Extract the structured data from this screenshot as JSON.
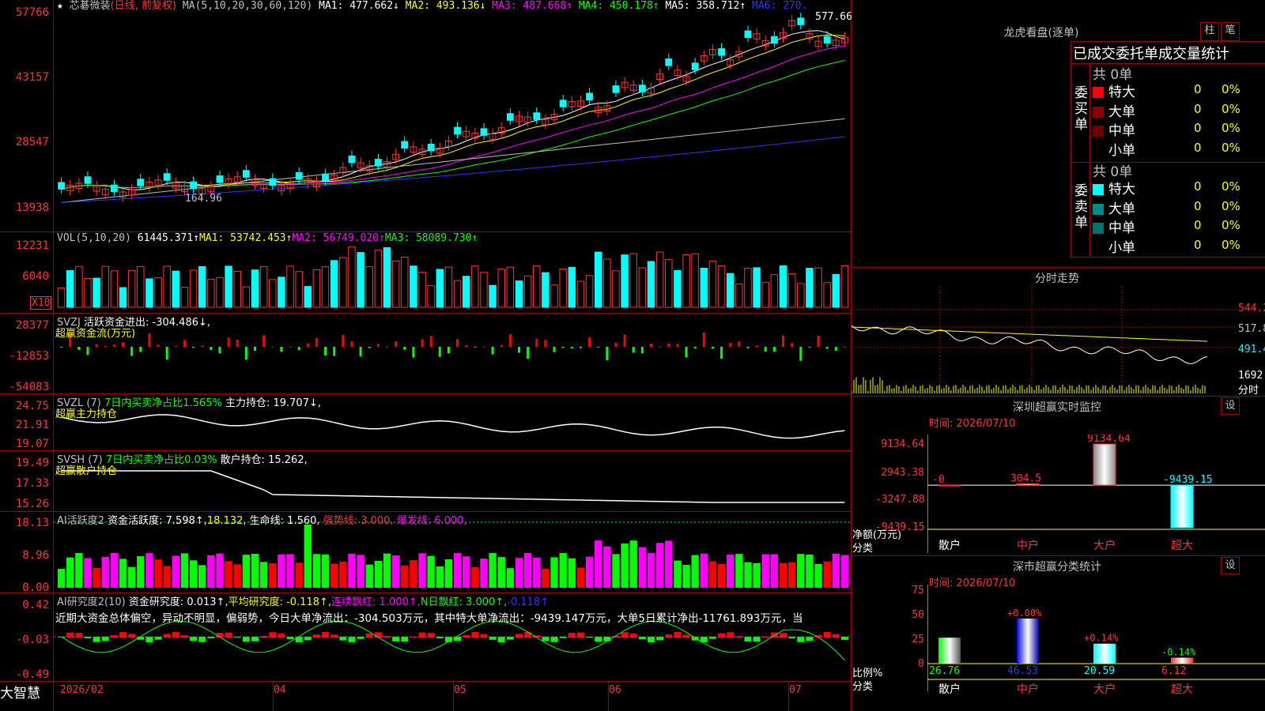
{
  "header": {
    "star": "★",
    "stock_name": "芯碁微装",
    "period": "(日线, 前复权)",
    "ma_label": "MA(5,10,20,30,60,120)",
    "ma1": "MA1: 477.662↓",
    "ma2": "MA2: 493.136↓",
    "ma3": "MA3: 487.668↑",
    "ma4": "MA4: 450.178↑",
    "ma5": "MA5: 358.712↑",
    "ma6": "MA6: 270."
  },
  "price_axis": [
    "57766",
    "43157",
    "28547",
    "13938"
  ],
  "price_annotations": {
    "high": "577.66",
    "low": "164.96"
  },
  "vol": {
    "label": "VOL(5,10,20)",
    "value": "61445.371↑",
    "ma1": "MA1: 53742.453↑",
    "ma2": "MA2: 56749.020↑",
    "ma3": "MA3: 58089.730↑",
    "axis": [
      "12231",
      "6040"
    ],
    "unit": "X10"
  },
  "svzj": {
    "label": "SVZJ",
    "line1": "活跃资金进出: -304.486↓,",
    "line2": "超赢资金流(万元)",
    "axis": [
      "28377",
      "-12853",
      "-54083"
    ]
  },
  "svzl": {
    "label": "SVZL (7)",
    "line1a": "7日内买卖净占比1.565%",
    "line1b": "主力持仓: 19.707↓,",
    "line2": "超赢主力持仓",
    "axis": [
      "24.75",
      "21.91",
      "19.07"
    ]
  },
  "svsh": {
    "label": "SVSH (7)",
    "line1a": "7日内买卖净占比0.03%",
    "line1b": "散户持仓: 15.262,",
    "line2": "超赢散户持仓",
    "axis": [
      "19.49",
      "17.33",
      "15.26"
    ]
  },
  "ai1": {
    "label": "AI活跃度2",
    "v1": "资金活跃度: 7.598↑,",
    "v2": "18.132,",
    "v3": "生命线: 1.560,",
    "v4": "强势线: 3.000,",
    "v5": "爆发线: 6.000,",
    "axis": [
      "18.13",
      "8.96",
      "0.00"
    ]
  },
  "ai2": {
    "label": "AI研究度2(10)",
    "v1": "资金研究度: 0.013↑,",
    "v2": "平均研究度: -0.118↑,",
    "v3": "连续飘红: 1.000↑,",
    "v4": "N日飘红: 3.000↑,",
    "v5": "-0.118↑",
    "comment": "近期大资金总体偏空，异动不明显，偏弱势，今日大单净流出：-304.503万元，其中特大单净流出：-9439.147万元，大单5日累计净出-11761.893万元，当",
    "axis": [
      "0.42",
      "-0.03",
      "-0.49"
    ]
  },
  "date_axis": [
    "2026/02",
    "04",
    "05",
    "06",
    "07"
  ],
  "brand": "大智慧",
  "lhb": {
    "title": "龙虎看盘(逐单)",
    "btn1": "柱",
    "btn2": "笔",
    "subtitle": "已成交委托单成交量统计",
    "buy_label": "委买单",
    "sell_label": "委卖单",
    "buy_total": "共 0单",
    "sell_total": "共 0单",
    "buy_rows": [
      {
        "name": "特大",
        "count": "0",
        "pct": "0%",
        "color": "#ff0000"
      },
      {
        "name": "大单",
        "count": "0",
        "pct": "0%",
        "color": "#8b0000"
      },
      {
        "name": "中单",
        "count": "0",
        "pct": "0%",
        "color": "#6e0000"
      },
      {
        "name": "小单",
        "count": "0",
        "pct": "0%",
        "color": "#000000"
      }
    ],
    "sell_rows": [
      {
        "name": "特大",
        "count": "0",
        "pct": "0%",
        "color": "#00ffff"
      },
      {
        "name": "大单",
        "count": "0",
        "pct": "0%",
        "color": "#008b8b"
      },
      {
        "name": "中单",
        "count": "0",
        "pct": "0%",
        "color": "#007070"
      },
      {
        "name": "小单",
        "count": "0",
        "pct": "0%",
        "color": "#000000"
      }
    ]
  },
  "intraday": {
    "title": "分时走势",
    "axis": [
      "544.2",
      "517.8",
      "491.4",
      "1692",
      "分时"
    ]
  },
  "sz_monitor": {
    "title": "深圳超赢实时监控",
    "btn": "设",
    "time": "时间: 2026/07/10",
    "axis": [
      "9134.64",
      "2943.38",
      "-3247.88",
      "-9439.15"
    ],
    "ylabel1": "净额(万元)",
    "ylabel2": "分类",
    "categories": [
      "散户",
      "中户",
      "大户",
      "超大"
    ],
    "values": [
      0,
      304.5,
      9134.64,
      -9439.15
    ],
    "value_labels": [
      "-0",
      "304.5",
      "9134.64",
      "-9439.15"
    ]
  },
  "sz_classify": {
    "title": "深市超赢分类统计",
    "btn": "设",
    "time": "时间: 2026/07/10",
    "axis": [
      "75",
      "50",
      "25",
      "0"
    ],
    "ylabel1": "比例%",
    "ylabel2": "分类",
    "categories": [
      "散户",
      "中户",
      "大户",
      "超大"
    ],
    "values": [
      26.76,
      46.53,
      20.59,
      6.12
    ],
    "value_labels": [
      "26.76",
      "46.53",
      "20.59",
      "6.12"
    ],
    "change_labels": [
      "",
      "+0.00%",
      "+0.14%",
      "-0.14%"
    ]
  }
}
